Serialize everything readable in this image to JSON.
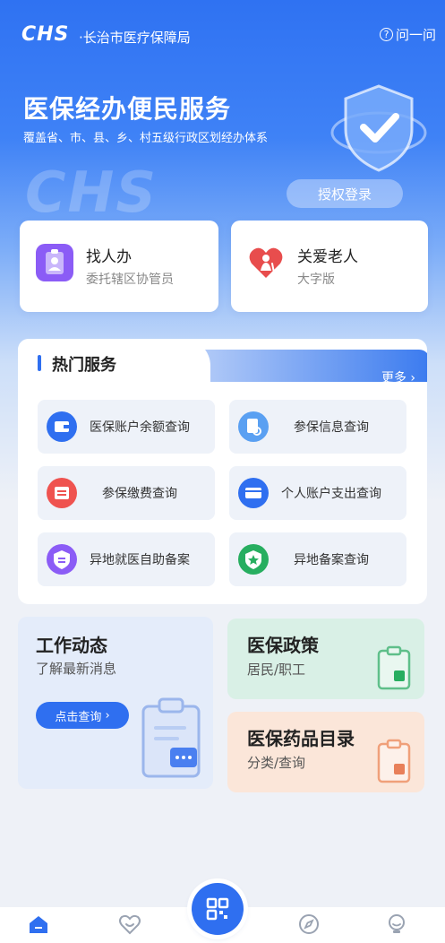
{
  "header": {
    "logo_text": "CHS",
    "org_name": "·长治市医疗保障局",
    "help_label": "问一问"
  },
  "hero": {
    "title": "医保经办便民服务",
    "subtitle": "覆盖省、市、县、乡、村五级行政区划经办体系",
    "watermark": "CHS",
    "login_button": "授权登录"
  },
  "quick_cards": [
    {
      "title": "找人办",
      "subtitle": "委托辖区协管员",
      "icon": "person-badge-icon"
    },
    {
      "title": "关爱老人",
      "subtitle": "大字版",
      "icon": "heart-elder-icon"
    }
  ],
  "hot_services": {
    "title": "热门服务",
    "more_label": "更多",
    "items": [
      {
        "label": "医保账户余额查询",
        "icon": "wallet-icon"
      },
      {
        "label": "参保信息查询",
        "icon": "document-search-icon"
      },
      {
        "label": "参保缴费查询",
        "icon": "payment-icon"
      },
      {
        "label": "个人账户支出查询",
        "icon": "card-icon"
      },
      {
        "label": "异地就医自助备案",
        "icon": "shield-record-icon"
      },
      {
        "label": "异地备案查询",
        "icon": "shield-star-icon"
      }
    ]
  },
  "cards": {
    "work": {
      "title": "工作动态",
      "subtitle": "了解最新消息",
      "button": "点击查询"
    },
    "policy": {
      "title": "医保政策",
      "subtitle": "居民/职工"
    },
    "drugs": {
      "title": "医保药品目录",
      "subtitle": "分类/查询"
    }
  },
  "colors": {
    "primary": "#2f6ff0",
    "service_purple": "#8b5cf6",
    "service_red": "#ef5350",
    "service_green": "#27ae60",
    "policy_bg": "#d9f0e6",
    "drugs_bg": "#fbe6d9"
  },
  "tabbar": {
    "items": [
      "home-icon",
      "heart-icon",
      "qr-scan-icon",
      "compass-icon",
      "bulb-icon"
    ]
  }
}
